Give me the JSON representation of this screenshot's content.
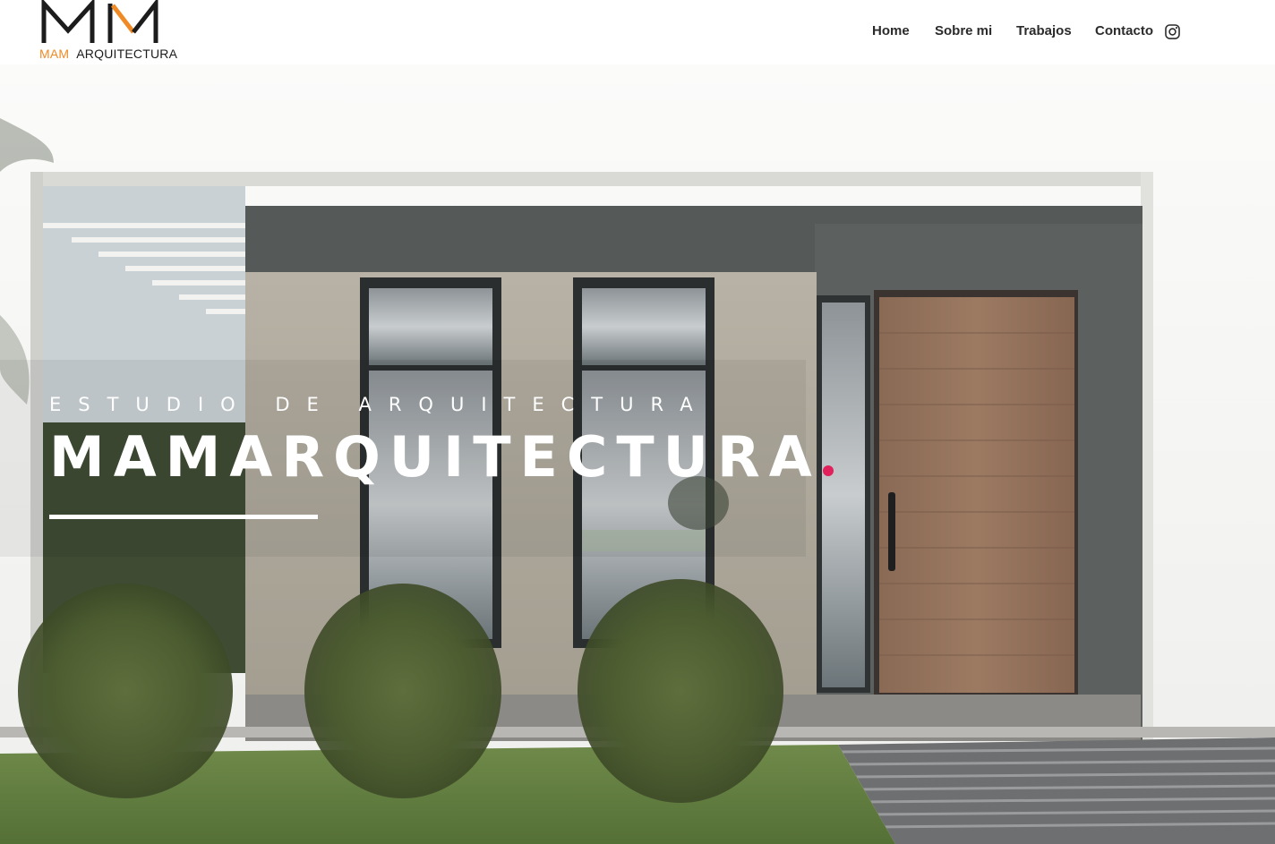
{
  "logo": {
    "brand_left": "MAM",
    "brand_right": "ARQUITECTURA",
    "accent_color": "#f08a24"
  },
  "nav": {
    "items": [
      {
        "label": "Home"
      },
      {
        "label": "Sobre mi"
      },
      {
        "label": "Trabajos"
      },
      {
        "label": "Contacto"
      }
    ],
    "social_icon": "instagram-icon"
  },
  "hero": {
    "subtitle": "ESTUDIO DE ARQUITECTURA",
    "title": "MAMARQUITECTURA",
    "dot_color": "#e0215b"
  }
}
